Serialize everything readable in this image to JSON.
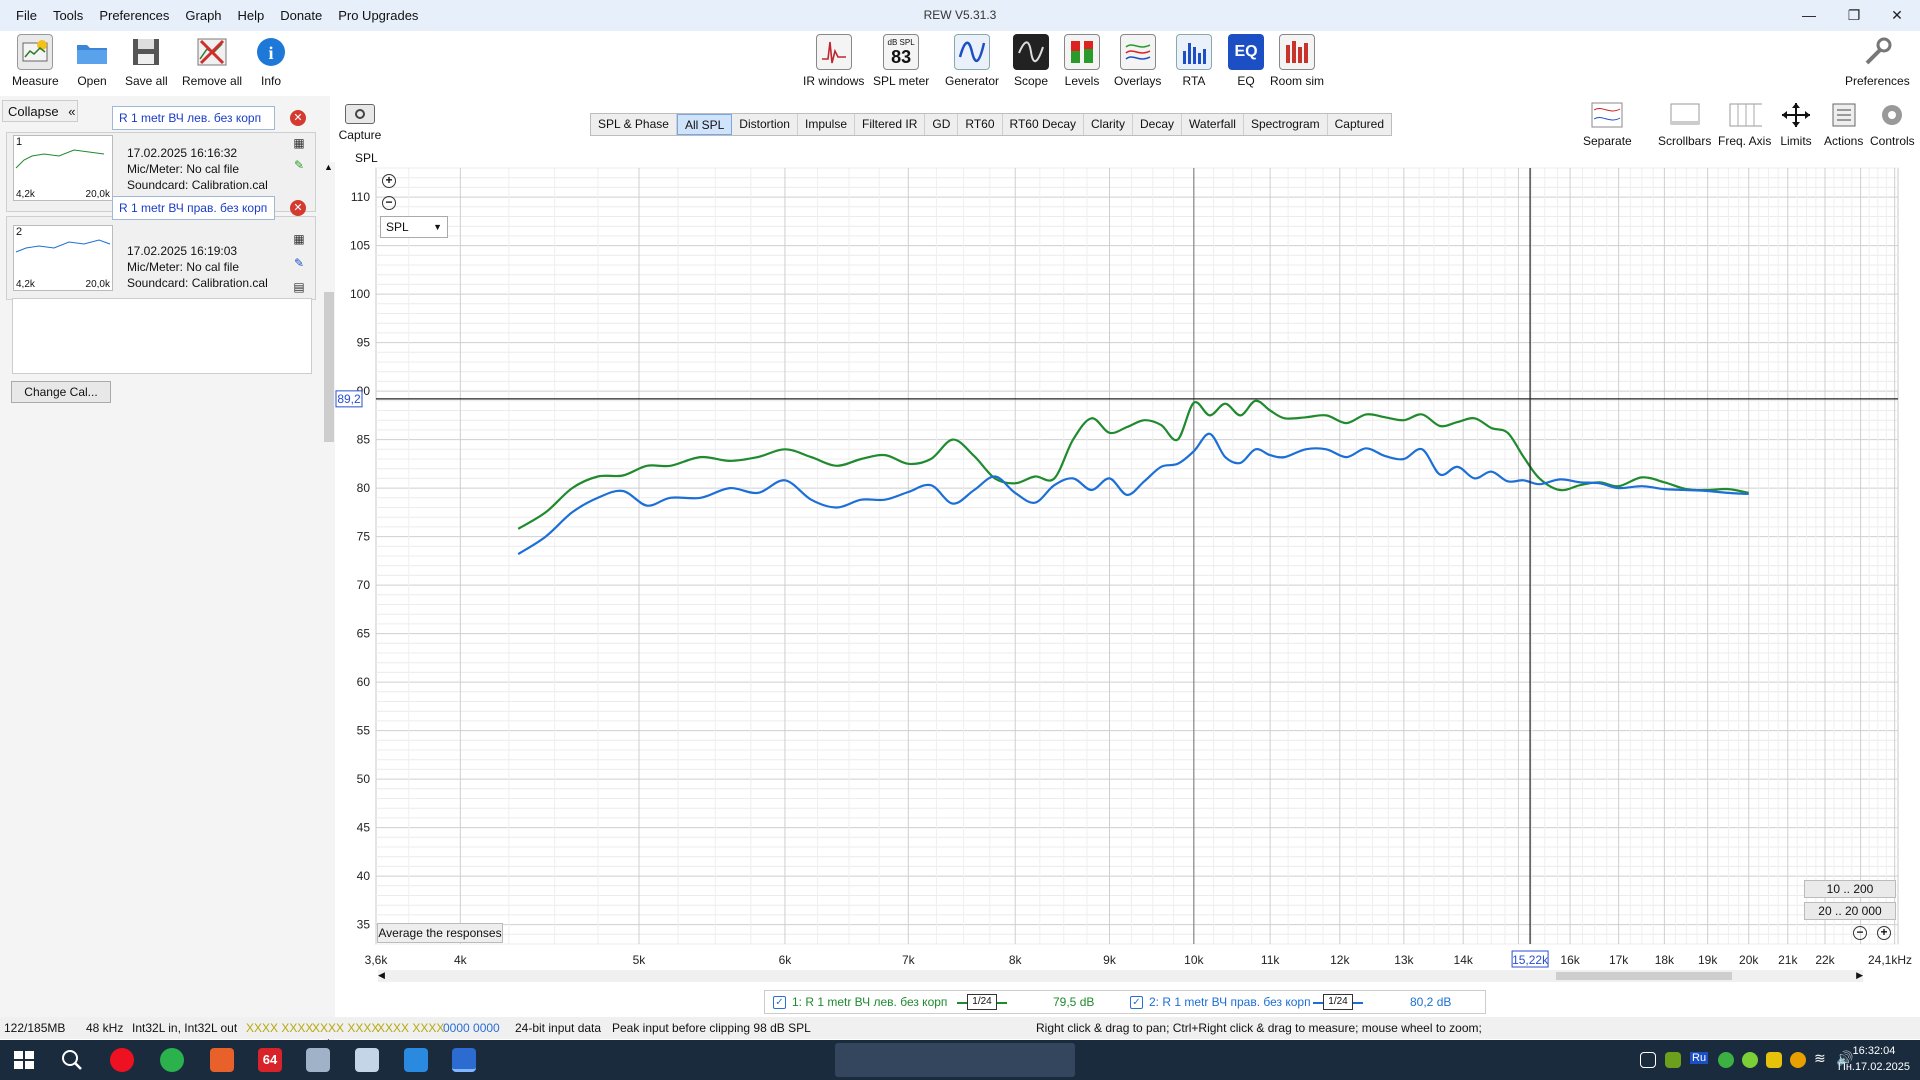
{
  "window": {
    "title": "REW V5.31.3",
    "menu": [
      "File",
      "Tools",
      "Preferences",
      "Graph",
      "Help",
      "Donate",
      "Pro Upgrades"
    ]
  },
  "toolbar": {
    "left": [
      {
        "label": "Measure",
        "icon": "measure-icon"
      },
      {
        "label": "Open",
        "icon": "folder-icon"
      },
      {
        "label": "Save all",
        "icon": "save-icon"
      },
      {
        "label": "Remove all",
        "icon": "remove-icon"
      },
      {
        "label": "Info",
        "icon": "info-icon"
      }
    ],
    "center": [
      {
        "label": "IR windows",
        "icon": "ir-windows-icon"
      },
      {
        "label": "SPL meter",
        "icon": "spl-meter-icon",
        "badge_top": "dB SPL",
        "badge_value": "83"
      },
      {
        "label": "Generator",
        "icon": "generator-icon"
      },
      {
        "label": "Scope",
        "icon": "scope-icon"
      },
      {
        "label": "Levels",
        "icon": "levels-icon"
      },
      {
        "label": "Overlays",
        "icon": "overlays-icon"
      },
      {
        "label": "RTA",
        "icon": "rta-icon"
      },
      {
        "label": "EQ",
        "icon": "eq-icon"
      },
      {
        "label": "Room sim",
        "icon": "room-sim-icon"
      }
    ],
    "preferences": "Preferences"
  },
  "left_panel": {
    "collapse": "Collapse",
    "measurements": [
      {
        "index": "1",
        "name": "R 1 metr ВЧ лев. без корп",
        "date": "17.02.2025 16:16:32",
        "mic": "Mic/Meter: No cal file",
        "soundcard": "Soundcard: Calibration.cal",
        "range_low": "4,2k",
        "range_high": "20,0k"
      },
      {
        "index": "2",
        "name": "R 1 metr ВЧ прав. без корп",
        "date": "17.02.2025 16:19:03",
        "mic": "Mic/Meter: No cal file",
        "soundcard": "Soundcard: Calibration.cal",
        "range_low": "4,2k",
        "range_high": "20,0k"
      }
    ],
    "change_cal": "Change Cal..."
  },
  "graph_tabs": [
    "SPL & Phase",
    "All SPL",
    "Distortion",
    "Impulse",
    "Filtered IR",
    "GD",
    "RT60",
    "RT60 Decay",
    "Clarity",
    "Decay",
    "Waterfall",
    "Spectrogram",
    "Captured"
  ],
  "active_tab": "All SPL",
  "capture_label": "Capture",
  "right_tools": [
    "Separate",
    "Scrollbars",
    "Freq. Axis",
    "Limits",
    "Actions",
    "Controls"
  ],
  "graph": {
    "y_axis_label": "SPL",
    "y_select": "SPL",
    "cursor_y_label": "89,2",
    "cursor_x_label": "15,22k",
    "average_button": "Average the responses",
    "range_buttons": [
      "10 .. 200",
      "20 .. 20 000"
    ]
  },
  "chart_data": {
    "type": "line",
    "title": "",
    "xlabel": "",
    "ylabel": "SPL",
    "x_scale": "log",
    "x_unit": "Hz",
    "xlim": [
      3600,
      24100
    ],
    "ylim": [
      33,
      113
    ],
    "y_ticks": [
      35,
      40,
      45,
      50,
      55,
      60,
      65,
      70,
      75,
      80,
      85,
      90,
      95,
      100,
      105,
      110
    ],
    "x_tick_labels": [
      "3,6k",
      "4k",
      "5k",
      "6k",
      "7k",
      "8k",
      "9k",
      "10k",
      "11k",
      "12k",
      "13k",
      "14k",
      "15,22k",
      "16k",
      "17k",
      "18k",
      "19k",
      "20k",
      "21k",
      "22k",
      "24,1kHz"
    ],
    "x_tick_values": [
      3600,
      4000,
      5000,
      6000,
      7000,
      8000,
      9000,
      10000,
      11000,
      12000,
      13000,
      14000,
      15220,
      16000,
      17000,
      18000,
      19000,
      20000,
      21000,
      22000,
      24100
    ],
    "cursor": {
      "x": 15220,
      "y": 89.2
    },
    "grid": true,
    "series": [
      {
        "name": "1: R 1 metr ВЧ лев. без корп",
        "color": "#1f8a2e",
        "x": [
          4300,
          4450,
          4600,
          4750,
          4900,
          5050,
          5200,
          5400,
          5600,
          5800,
          6000,
          6200,
          6400,
          6600,
          6800,
          7000,
          7200,
          7400,
          7600,
          7800,
          8000,
          8200,
          8400,
          8600,
          8800,
          9000,
          9200,
          9400,
          9600,
          9800,
          10000,
          10200,
          10400,
          10600,
          10800,
          11000,
          11200,
          11500,
          11800,
          12100,
          12400,
          12700,
          13000,
          13300,
          13600,
          13900,
          14200,
          14500,
          14800,
          15100,
          15400,
          15800,
          16200,
          16600,
          17000,
          17500,
          18000,
          18500,
          19000,
          19500,
          20000
        ],
        "values": [
          75.8,
          77.5,
          80.0,
          81.2,
          81.3,
          82.3,
          82.3,
          83.2,
          82.8,
          83.2,
          84.0,
          83.2,
          82.3,
          83.0,
          83.4,
          82.5,
          83.0,
          85.0,
          83.3,
          81.0,
          80.5,
          81.2,
          81.0,
          85.0,
          87.2,
          85.7,
          86.3,
          87.0,
          86.5,
          85.0,
          88.8,
          87.5,
          88.7,
          87.5,
          89.0,
          88.0,
          87.2,
          87.3,
          87.5,
          86.7,
          87.6,
          87.3,
          87.0,
          87.6,
          86.4,
          86.8,
          87.2,
          86.2,
          85.7,
          83.2,
          81.0,
          79.8,
          80.3,
          80.6,
          80.2,
          81.1,
          80.6,
          79.9,
          79.8,
          79.9,
          79.5
        ],
        "smoothing": "1/24",
        "level": "79,5 dB"
      },
      {
        "name": "2: R 1 metr ВЧ прав. без корп",
        "color": "#1c6fd6",
        "x": [
          4300,
          4450,
          4600,
          4750,
          4900,
          5050,
          5200,
          5400,
          5600,
          5800,
          6000,
          6200,
          6400,
          6600,
          6800,
          7000,
          7200,
          7400,
          7600,
          7800,
          8000,
          8200,
          8400,
          8600,
          8800,
          9000,
          9200,
          9400,
          9600,
          9800,
          10000,
          10200,
          10400,
          10600,
          10800,
          11000,
          11200,
          11500,
          11800,
          12100,
          12400,
          12700,
          13000,
          13300,
          13600,
          13900,
          14200,
          14500,
          14800,
          15100,
          15400,
          15800,
          16200,
          16600,
          17000,
          17500,
          18000,
          18500,
          19000,
          19500,
          20000
        ],
        "values": [
          73.2,
          75.0,
          77.5,
          79.0,
          79.7,
          78.2,
          79.0,
          79.0,
          80.0,
          79.5,
          80.8,
          78.8,
          78.0,
          78.8,
          78.8,
          79.6,
          80.3,
          78.4,
          79.8,
          81.2,
          79.5,
          78.5,
          80.3,
          81.0,
          79.8,
          81.0,
          79.3,
          80.7,
          82.2,
          82.5,
          83.8,
          85.6,
          83.2,
          82.6,
          84.0,
          83.4,
          83.2,
          84.0,
          84.0,
          83.2,
          84.1,
          83.3,
          83.0,
          84.0,
          81.4,
          82.2,
          81.0,
          81.7,
          80.7,
          80.8,
          80.4,
          80.9,
          80.6,
          80.5,
          80.0,
          80.2,
          79.9,
          79.8,
          79.7,
          79.5,
          79.4
        ],
        "smoothing": "1/24",
        "level": "80,2 dB"
      }
    ]
  },
  "status_bar": {
    "memory": "122/185MB",
    "rate": "48 kHz",
    "format": "Int32L in, Int32L out",
    "meter1": "XXXX XXXX",
    "meter2": "XXXX XXXX",
    "meter3": "XXXX XXXX",
    "meter4": "0000 0000",
    "input": "24-bit input data",
    "peak": "Peak input before clipping 98 dB SPL",
    "hint": "Right click & drag to pan; Ctrl+Right click & drag to measure; mouse wheel to zoom;"
  },
  "taskbar": {
    "time": "16:32:04",
    "date": "Пн.17.02.2025",
    "lang": "Ru"
  }
}
